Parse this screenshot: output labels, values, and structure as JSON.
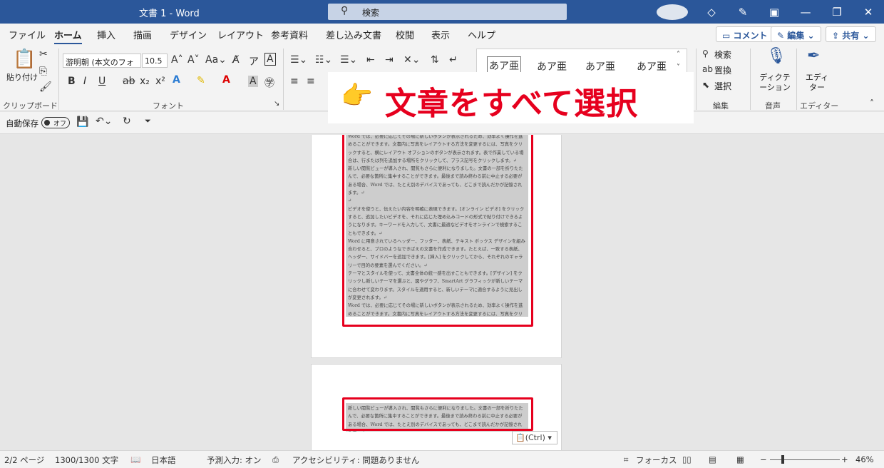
{
  "window": {
    "title": "文書 1 - Word",
    "search_placeholder": "検索"
  },
  "tabs": [
    "ファイル",
    "ホーム",
    "挿入",
    "描画",
    "デザイン",
    "レイアウト",
    "参考資料",
    "差し込み文書",
    "校閲",
    "表示",
    "ヘルプ"
  ],
  "active_tab": "ホーム",
  "ribbon_actions": {
    "comment": "コメント",
    "edit": "編集",
    "share": "共有"
  },
  "clipboard": {
    "paste": "貼り付け",
    "group": "クリップボード"
  },
  "font": {
    "name": "游明朝 (本文のフォ",
    "size": "10.5",
    "group": "フォント"
  },
  "styles": [
    "あア亜",
    "あア亜",
    "あア亜",
    "あア亜"
  ],
  "editing": {
    "find": "検索",
    "replace": "置換",
    "select": "選択",
    "group": "編集"
  },
  "voice": {
    "dictate": "ディクテーション",
    "group": "音声"
  },
  "editor": {
    "label": "エディター",
    "group": "エディター"
  },
  "qat": {
    "autosave": "自動保存",
    "toggle": "オフ"
  },
  "callout": {
    "text": "文章をすべて選択"
  },
  "document": {
    "page1": [
      "Word では、必要に応じてその場に新しいボタンが表示されるため、効率よく操作を進めることができます。文書内に写真をレイアウトする方法を変更するには、写真をクリックすると、横にレイアウト オプションのボタンが表示されます。表で作業している場合は、行または列を追加する場所をクリックして、プラス記号をクリックします。↵",
      "新しい閲覧ビューが導入され、閲覧もさらに便利になりました。文書の一部を折りたたんで、必要な箇所に集中することができます。最後まで読み終わる前に中止する必要がある場合、Word では、たとえ別のデバイスであっても、どこまで読んだかが記憶されます。↵",
      "↵",
      "ビデオを使うと、伝えたい内容を明確に表現できます。[オンライン ビデオ] をクリックすると、追加したいビデオを、それに応じた埋め込みコードの形式で貼り付けできるようになります。キーワードを入力して、文書に最適なビデオをオンラインで検索することもできます。↵",
      "Word に用意されているヘッダー、フッター、表紙、テキスト ボックス デザインを組み合わせると、プロのようなできばえの文書を作成できます。たとえば、一致する表紙、ヘッダー、サイドバーを追加できます。[挿入] をクリックしてから、それぞれのギャラリーで目的の要素を選んでください。↵",
      "テーマとスタイルを使って、文書全体の統一感を出すこともできます。[デザイン] をクリックし新しいテーマを選ぶと、図やグラフ、SmartArt グラフィックが新しいテーマに合わせて変わります。スタイルを適用すると、新しいテーマに適合するように見出しが変更されます。↵",
      "Word では、必要に応じてその場に新しいボタンが表示されるため、効率よく操作を進めることができます。文書内に写真をレイアウトする方法を変更するには、写真をクリックすると、横にレイアウト オプションのボタンが表示されます。表で作業している場合は、行または列を追加する場所をクリックして、プラス記号をクリックします。↵"
    ],
    "page2": [
      "新しい閲覧ビューが導入され、閲覧もさらに便利になりました。文書の一部を折りたたんで、必要な箇所に集中することができます。最後まで読み終わる前に中止する必要がある場合、Word では、たとえ別のデバイスであっても、どこまで読んだかが記憶されます。↵"
    ],
    "ctrl_button": "(Ctrl)"
  },
  "status": {
    "page": "2/2 ページ",
    "words": "1300/1300 文字",
    "language": "日本語",
    "predict": "予測入力: オン",
    "accessibility": "アクセシビリティ: 問題ありません",
    "focus": "フォーカス",
    "zoom": "46%"
  }
}
